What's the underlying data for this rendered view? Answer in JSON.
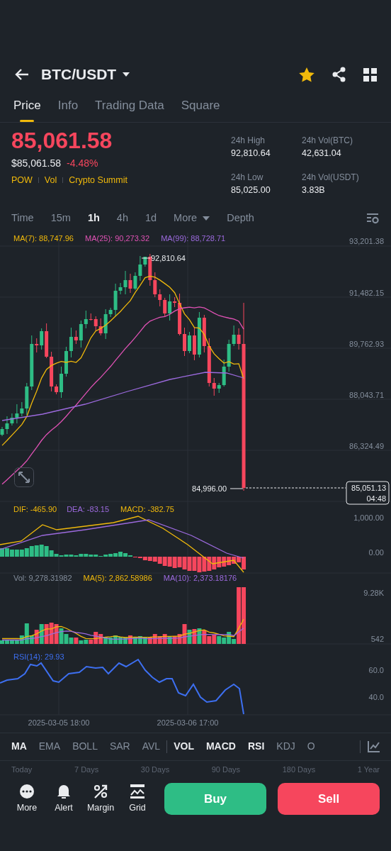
{
  "header": {
    "title": "BTC/USDT",
    "favorite": true
  },
  "tabs": [
    {
      "label": "Price",
      "selected": true
    },
    {
      "label": "Info",
      "selected": false
    },
    {
      "label": "Trading Data",
      "selected": false
    },
    {
      "label": "Square",
      "selected": false
    }
  ],
  "price": {
    "last": "85,061.58",
    "usd": "$85,061.58",
    "change": "-4.48%",
    "tags": [
      "POW",
      "Vol",
      "Crypto Summit"
    ]
  },
  "stats": [
    {
      "label": "24h High",
      "value": "92,810.64"
    },
    {
      "label": "24h Vol(BTC)",
      "value": "42,631.04"
    },
    {
      "label": "24h Low",
      "value": "85,025.00"
    },
    {
      "label": "24h Vol(USDT)",
      "value": "3.83B"
    }
  ],
  "intervals": [
    {
      "label": "Time",
      "selected": false,
      "kind": "plain"
    },
    {
      "label": "15m",
      "selected": false,
      "kind": "plain"
    },
    {
      "label": "1h",
      "selected": true,
      "kind": "plain"
    },
    {
      "label": "4h",
      "selected": false,
      "kind": "plain"
    },
    {
      "label": "1d",
      "selected": false,
      "kind": "plain"
    },
    {
      "label": "More",
      "selected": false,
      "kind": "dropdown"
    },
    {
      "label": "Depth",
      "selected": false,
      "kind": "plain"
    }
  ],
  "main_chart": {
    "legend": [
      {
        "label": "MA(7): 88,747.96",
        "color": "#f0b90b"
      },
      {
        "label": "MA(25): 90,273.32",
        "color": "#e052b5"
      },
      {
        "label": "MA(99): 88,728.71",
        "color": "#9c6ade"
      }
    ],
    "yticks": [
      "93,201.38",
      "91,482.15",
      "89,762.93",
      "88,043.71",
      "86,324.49"
    ],
    "high_label": "92,810.64",
    "low_label": "84,996.00",
    "last_price": "85,051.13",
    "countdown": "04:48"
  },
  "macd": {
    "legend": [
      {
        "label": "DIF: -465.90",
        "color": "#f0b90b"
      },
      {
        "label": "DEA: -83.15",
        "color": "#9c6ade"
      },
      {
        "label": "MACD: -382.75",
        "color": "#f0b90b"
      }
    ],
    "yticks": [
      "1,000.00",
      "0.00"
    ]
  },
  "volume": {
    "legend": [
      {
        "label": "Vol: 9,278.31982",
        "color": "#848e9c"
      },
      {
        "label": "MA(5): 2,862.58986",
        "color": "#f0b90b"
      },
      {
        "label": "MA(10): 2,373.18176",
        "color": "#9c6ade"
      }
    ],
    "yticks": [
      "9.28K",
      "542"
    ]
  },
  "rsi": {
    "legend": [
      {
        "label": "RSI(14): 29.93",
        "color": "#3d6ff0"
      }
    ],
    "yticks": [
      "60.0",
      "40.0"
    ]
  },
  "dates": [
    "2025-03-05 18:00",
    "2025-03-06 17:00"
  ],
  "main_indicators": [
    {
      "label": "MA",
      "selected": true
    },
    {
      "label": "EMA",
      "selected": false
    },
    {
      "label": "BOLL",
      "selected": false
    },
    {
      "label": "SAR",
      "selected": false
    },
    {
      "label": "AVL",
      "selected": false
    }
  ],
  "sub_indicators": [
    {
      "label": "VOL",
      "selected": true
    },
    {
      "label": "MACD",
      "selected": true
    },
    {
      "label": "RSI",
      "selected": true
    },
    {
      "label": "KDJ",
      "selected": false
    },
    {
      "label": "O",
      "selected": false
    }
  ],
  "periods": [
    "Today",
    "7 Days",
    "30 Days",
    "90 Days",
    "180 Days",
    "1 Year"
  ],
  "actions": [
    {
      "label": "More",
      "kind": "more"
    },
    {
      "label": "Alert",
      "kind": "alert"
    },
    {
      "label": "Margin",
      "kind": "margin"
    },
    {
      "label": "Grid",
      "kind": "grid"
    }
  ],
  "buy": "Buy",
  "sell": "Sell"
}
